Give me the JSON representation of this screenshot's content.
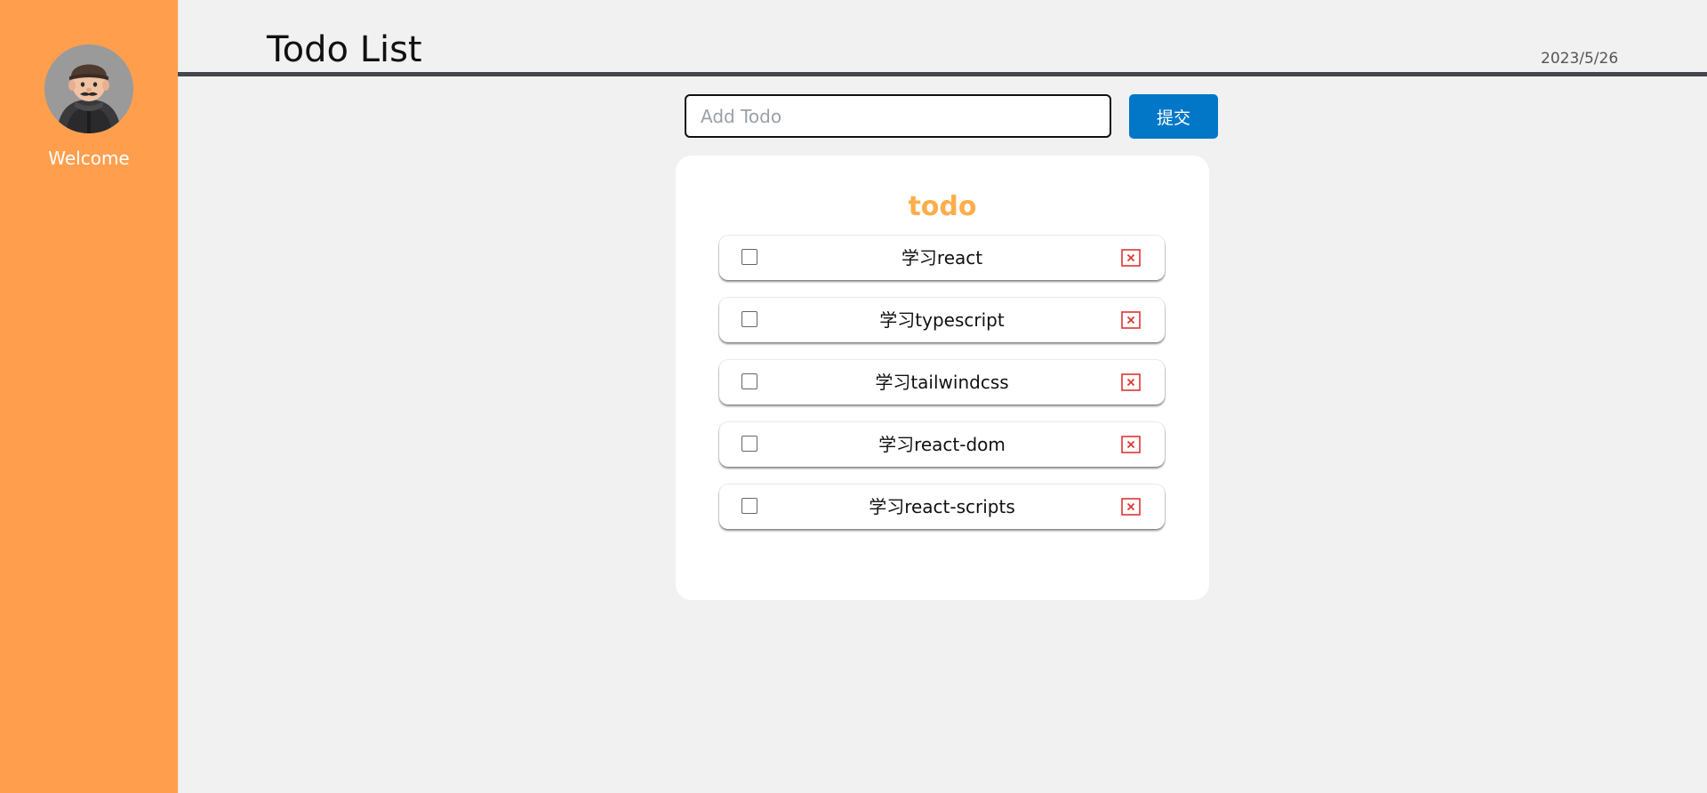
{
  "sidebar": {
    "welcome": "Welcome",
    "avatar_icon": "user-avatar-icon",
    "background_color": "#ff9f4e"
  },
  "header": {
    "title": "Todo List",
    "date": "2023/5/26"
  },
  "add_form": {
    "placeholder": "Add Todo",
    "value": "",
    "submit_label": "提交",
    "submit_color": "#0277c7"
  },
  "todo_card": {
    "title": "todo",
    "title_color": "#ffad4b",
    "items": [
      {
        "text": "学习react",
        "checked": false
      },
      {
        "text": "学习typescript",
        "checked": false
      },
      {
        "text": "学习tailwindcss",
        "checked": false
      },
      {
        "text": "学习react-dom",
        "checked": false
      },
      {
        "text": "学习react-scripts",
        "checked": false
      }
    ],
    "delete_icon": "close-box-icon",
    "delete_color": "#e03434"
  }
}
